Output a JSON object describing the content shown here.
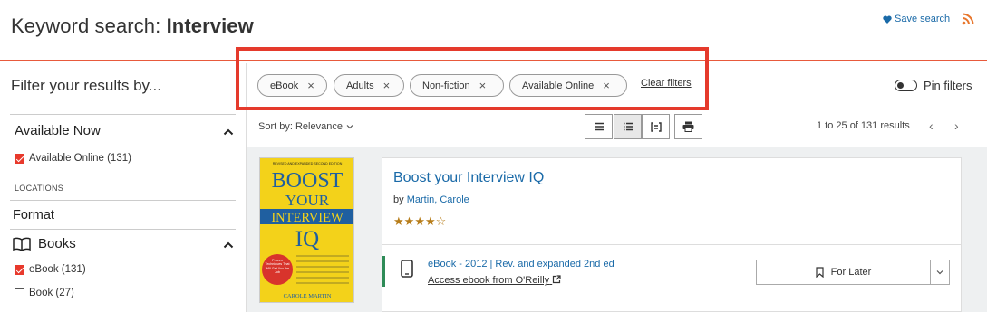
{
  "header": {
    "title_prefix": "Keyword search: ",
    "title_term": "Interview",
    "save_search_label": "Save search"
  },
  "sidebar": {
    "heading": "Filter your results by...",
    "available_now": {
      "label": "Available Now",
      "items": [
        {
          "label": "Available Online (131)",
          "checked": true
        }
      ]
    },
    "locations_label": "LOCATIONS",
    "format_label": "Format",
    "books": {
      "label": "Books",
      "items": [
        {
          "label": "eBook (131)",
          "checked": true
        },
        {
          "label": "Book (27)",
          "checked": false
        }
      ]
    }
  },
  "filters": {
    "chips": [
      "eBook",
      "Adults",
      "Non-fiction",
      "Available Online"
    ],
    "clear_label": "Clear filters",
    "pin_label": "Pin filters",
    "pin_on": false
  },
  "toolbar": {
    "sort_label": "Sort by: Relevance",
    "results_count": "1 to 25 of 131 results"
  },
  "result": {
    "title": "Boost your Interview IQ",
    "by_label": "by ",
    "author": "Martin, Carole",
    "rating": 4,
    "rating_max": 5,
    "edition": "eBook - 2012 | Rev. and expanded 2nd ed",
    "access_link": "Access ebook from O'Reilly",
    "for_later_label": "For Later",
    "cover": {
      "edition_note": "REVISED AND EXPANDED SECOND EDITION",
      "line1": "BOOST",
      "line2": "YOUR",
      "line3": "INTERVIEW",
      "line4": "IQ",
      "badge": "Proven Techniques That Will Get You the Job",
      "author": "CAROLE MARTIN"
    }
  },
  "colors": {
    "accent": "#e85a3c",
    "link": "#1a6aa8",
    "checkbox": "#e8392c",
    "star": "#b77d1a",
    "available": "#2e8b57"
  }
}
